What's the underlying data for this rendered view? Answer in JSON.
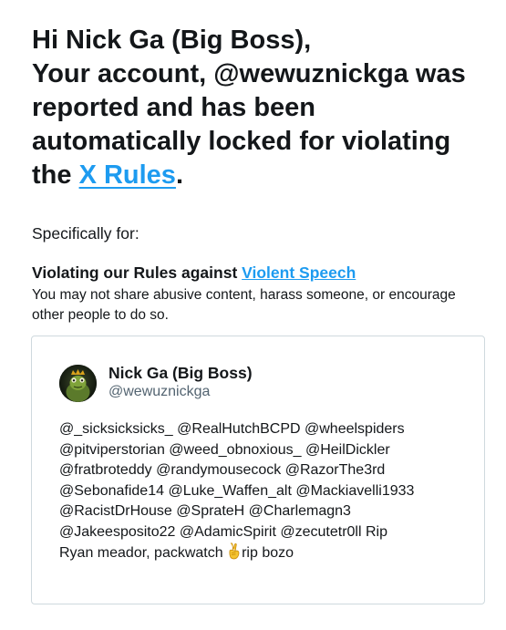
{
  "notice": {
    "greeting": "Hi Nick Ga (Big Boss),",
    "line_prefix": "Your account, @wewuznickga was reported and has been automatically locked for violating the ",
    "rules_link": "X Rules",
    "line_suffix": ".",
    "specifically": "Specifically for:",
    "rule_prefix": "Violating our Rules against ",
    "rule_link": "Violent Speech",
    "rule_description": "You may not share abusive content, harass someone, or encourage other people to do so."
  },
  "tweet": {
    "display_name": "Nick Ga (Big Boss)",
    "handle": "@wewuznickga",
    "text_lines": [
      "@_sicksicksicks_ @RealHutchBCPD @wheelspiders",
      "@pitviperstorian @weed_obnoxious_ @HeilDickler",
      "@fratbroteddy @randymousecock @RazorThe3rd",
      "@Sebonafide14 @Luke_Waffen_alt @Mackiavelli1933",
      "@RacistDrHouse @SprateH @Charlemagn3",
      "@Jakeesposito22 @AdamicSpirit @zecutetr0ll Rip"
    ],
    "last_line_before_emoji": "Ryan meador, packwatch ",
    "emoji_icon": "victory-hand-emoji",
    "last_line_after_emoji": "rip bozo"
  },
  "colors": {
    "link": "#1d9bf0",
    "text": "#14171a",
    "secondary_text": "#536471",
    "card_border": "#cfd9de"
  }
}
